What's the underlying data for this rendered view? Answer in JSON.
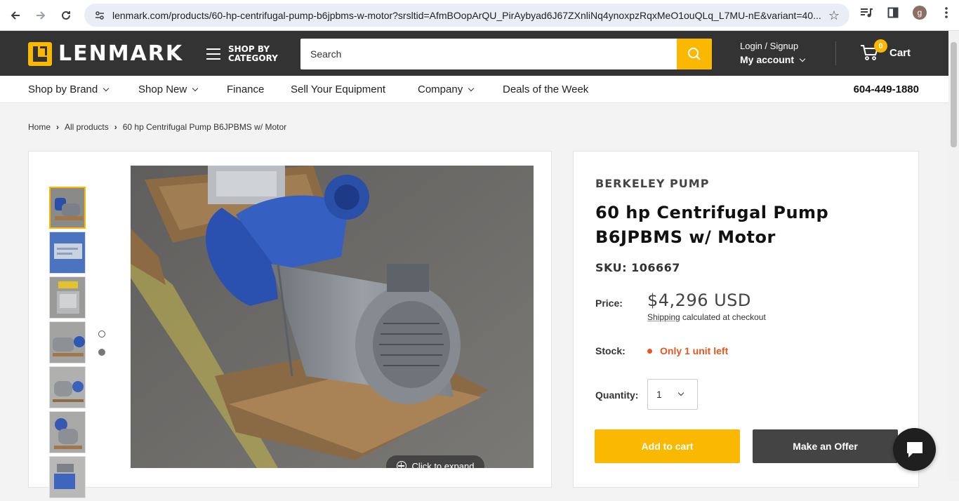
{
  "browser": {
    "url": "lenmark.com/products/60-hp-centrifugal-pump-b6jpbms-w-motor?srsltid=AfmBOopArQU_PirAybyad6J67ZXnliNq4ynoxpzRqxMeO1ouQLq_L7MU-nE&variant=40...",
    "profile_initial": "g"
  },
  "header": {
    "logo_text": "LENMARK",
    "shop_by_category_line1": "SHOP BY",
    "shop_by_category_line2": "CATEGORY",
    "search_placeholder": "Search",
    "login_label": "Login / Signup",
    "account_label": "My account",
    "cart_count": "0",
    "cart_label": "Cart"
  },
  "subnav": {
    "items": [
      {
        "label": "Shop by Brand",
        "dropdown": true
      },
      {
        "label": "Shop New",
        "dropdown": true
      },
      {
        "label": "Finance",
        "dropdown": false
      },
      {
        "label": "Sell Your Equipment",
        "dropdown": false
      },
      {
        "label": "Company",
        "dropdown": true
      },
      {
        "label": "Deals of the Week",
        "dropdown": false
      }
    ],
    "phone": "604-449-1880"
  },
  "breadcrumb": [
    "Home",
    "All products",
    "60 hp Centrifugal Pump B6JPBMS w/ Motor"
  ],
  "gallery": {
    "expand_label": "Click to expand",
    "thumbnail_count": 7
  },
  "product": {
    "vendor": "BERKELEY PUMP",
    "title": "60 hp Centrifugal Pump B6JPBMS w/ Motor",
    "sku": "SKU: 106667",
    "price_label": "Price:",
    "price": "$4,296 USD",
    "shipping_link": "Shipping",
    "shipping_rest": " calculated at checkout",
    "stock_label": "Stock:",
    "stock_status": "Only 1 unit left",
    "quantity_label": "Quantity:",
    "quantity_value": "1",
    "add_to_cart": "Add to cart",
    "make_offer": "Make an Offer"
  },
  "colors": {
    "brand_yellow": "#fbb800",
    "header_dark": "#333333",
    "stock_orange": "#e6561f"
  }
}
